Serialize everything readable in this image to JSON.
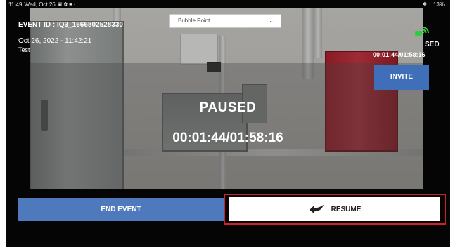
{
  "status_bar": {
    "time": "11:49",
    "date": "Wed, Oct 26",
    "battery": "13%"
  },
  "event": {
    "id_line": "EVENT ID : IQ3_1666802528330",
    "date_line": "Oct 26, 2022 - 11:42:21",
    "note": "Test"
  },
  "dropdown": {
    "selected": "Bubble Point"
  },
  "session": {
    "status_word": "SED",
    "timer_small": "00:01:44/01:58:16"
  },
  "invite_label": "INVITE",
  "overlay": {
    "paused_label": "PAUSED",
    "paused_time": "00:01:44/01:58:16"
  },
  "footer": {
    "end_label": "END EVENT",
    "resume_label": "RESUME"
  },
  "colors": {
    "primary_blue": "#4f79bd",
    "highlight_red": "#d2202a",
    "signal_green": "#2ecc40"
  }
}
